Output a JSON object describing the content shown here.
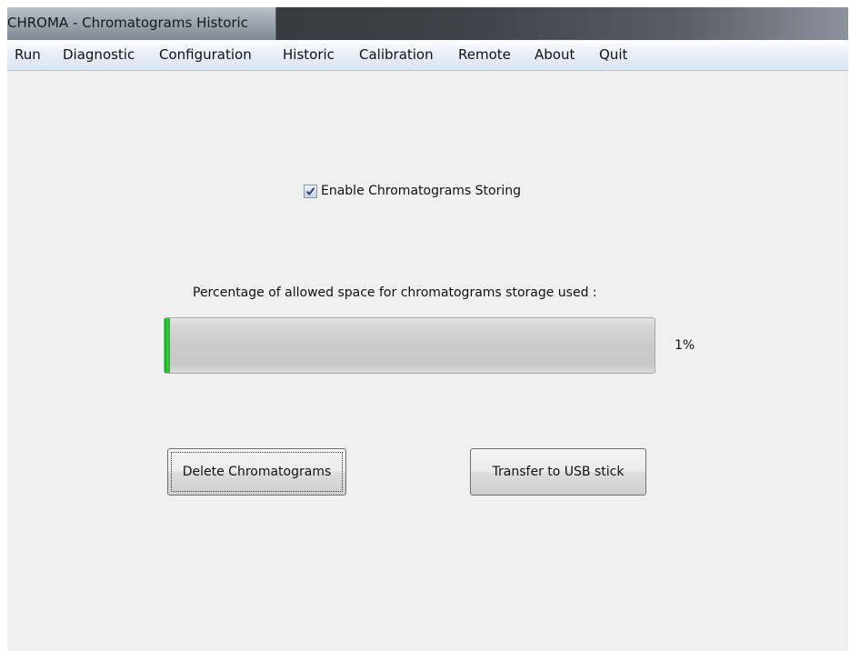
{
  "window": {
    "title": "CHROMA - Chromatograms Historic"
  },
  "menu": {
    "items": [
      "Run",
      "Diagnostic",
      "Configuration",
      "Historic",
      "Calibration",
      "Remote",
      "About",
      "Quit"
    ]
  },
  "storing": {
    "checkbox_label": "Enable Chromatograms Storing",
    "checked": true
  },
  "storage": {
    "label": "Percentage of allowed space for chromatograms storage used :",
    "percent": 1,
    "percent_text": "1%"
  },
  "buttons": {
    "delete_label": "Delete Chromatograms",
    "transfer_label": "Transfer to USB stick"
  },
  "colors": {
    "progress_fill": "#22c12f",
    "menubar": "#dce5f3",
    "content_bg": "#f0f0f0"
  }
}
